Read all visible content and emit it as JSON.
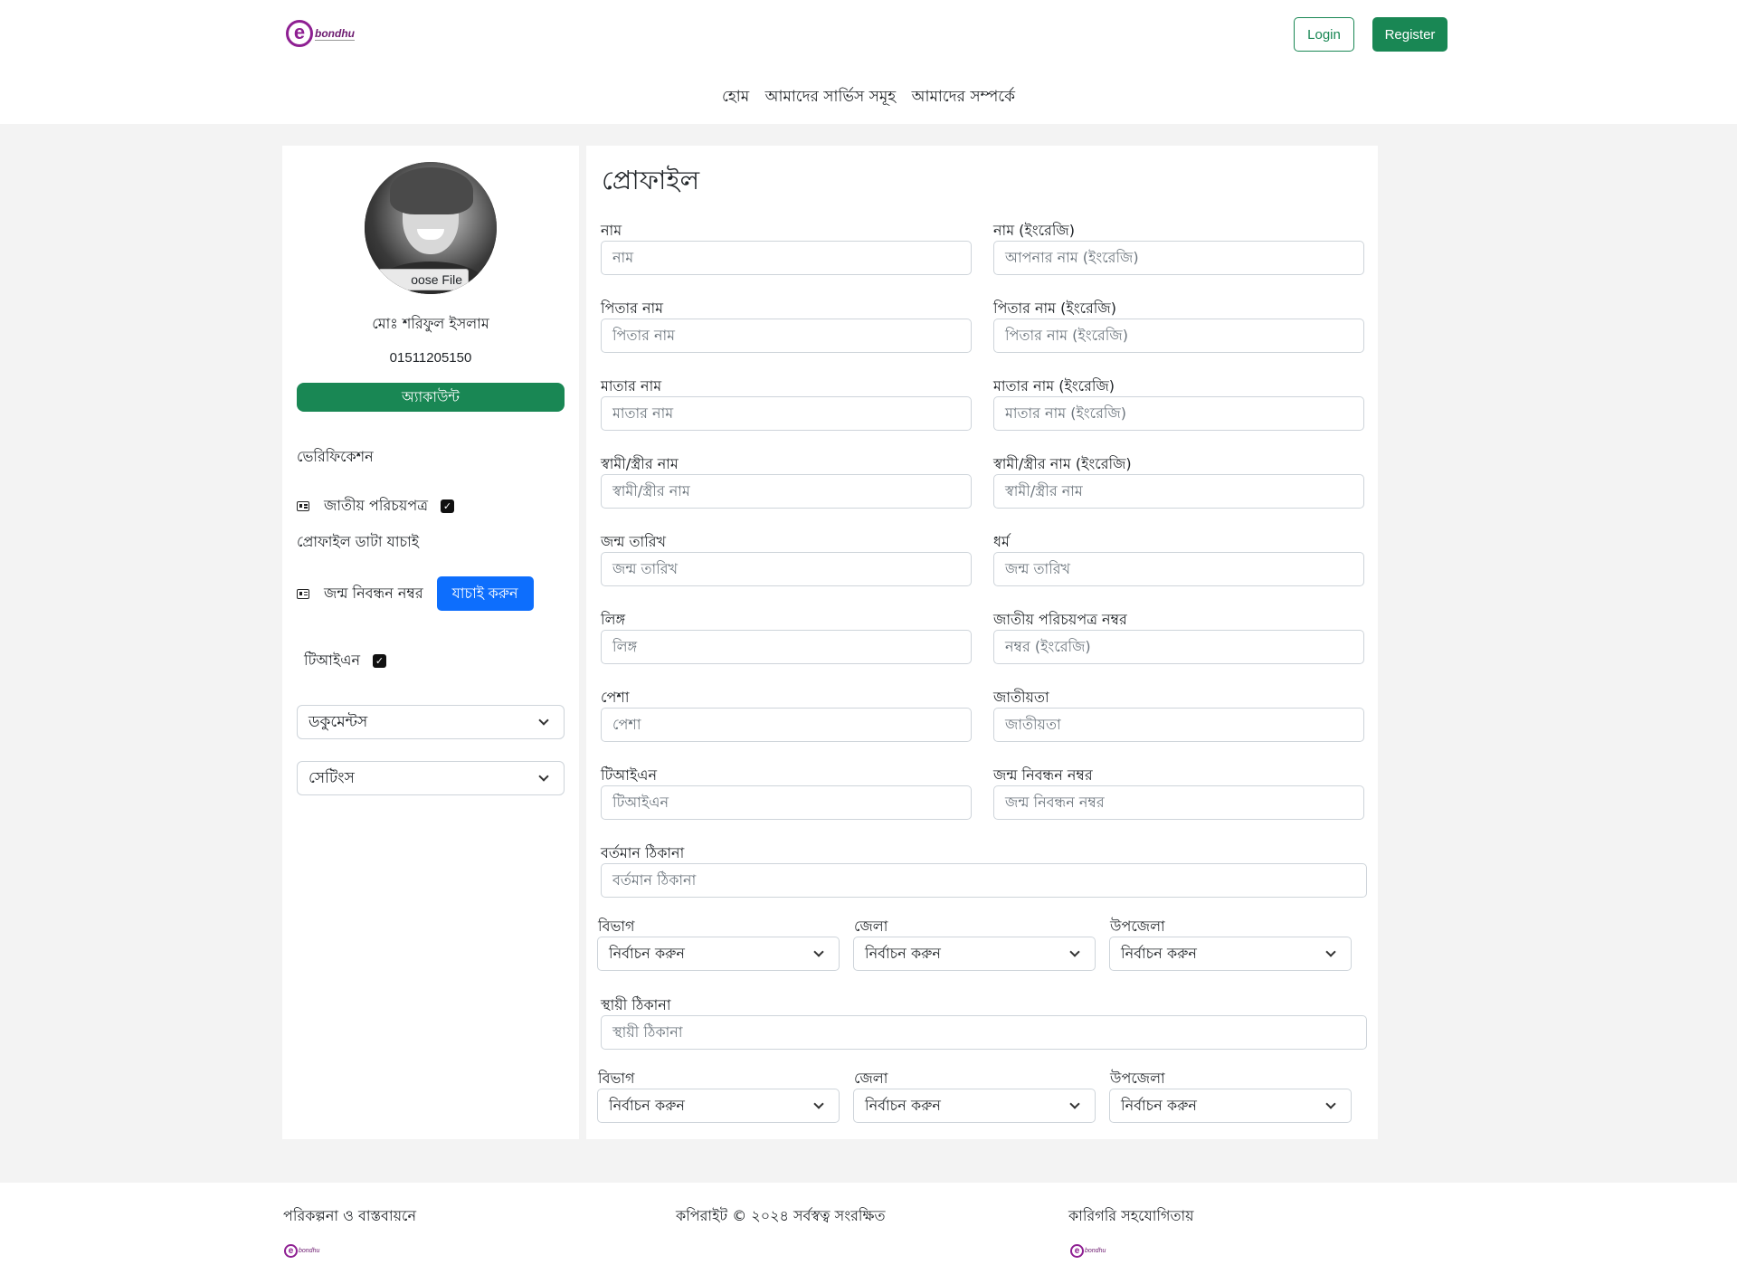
{
  "header": {
    "logo_letter": "e",
    "logo_text": "bondhu",
    "login_label": "Login",
    "register_label": "Register",
    "nav": [
      "হোম",
      "আমাদের সার্ভিস সমূহ",
      "আমাদের সম্পর্কে"
    ]
  },
  "sidebar": {
    "choose_file": "oose File",
    "user_name": "মোঃ শরিফুল ইসলাম",
    "phone": "01511205150",
    "account_label": "অ্যাকাউন্ট",
    "verification_title": "ভেরিফিকেশন",
    "nid_label": "জাতীয় পরিচয়পত্র",
    "profile_data_check": "প্রোফাইল ডাটা যাচাই",
    "birth_reg_label": "জন্ম নিবন্ধন নম্বর",
    "verify_button": "যাচাই করুন",
    "tin_label": "টিআইএন",
    "documents_label": "ডকুমেন্টস",
    "settings_label": "সেটিংস",
    "check_glyph": "✓"
  },
  "main": {
    "title": "প্রোফাইল",
    "fields": [
      {
        "label": "নাম",
        "placeholder": "নাম"
      },
      {
        "label": "নাম (ইংরেজি)",
        "placeholder": "আপনার নাম (ইংরেজি)"
      },
      {
        "label": "পিতার নাম",
        "placeholder": "পিতার নাম"
      },
      {
        "label": "পিতার নাম (ইংরেজি)",
        "placeholder": "পিতার নাম (ইংরেজি)"
      },
      {
        "label": "মাতার নাম",
        "placeholder": "মাতার নাম"
      },
      {
        "label": "মাতার নাম (ইংরেজি)",
        "placeholder": "মাতার  নাম (ইংরেজি)"
      },
      {
        "label": "স্বামী/স্ত্রীর নাম",
        "placeholder": "স্বামী/স্ত্রীর নাম"
      },
      {
        "label": "স্বামী/স্ত্রীর নাম (ইংরেজি)",
        "placeholder": "স্বামী/স্ত্রীর নাম"
      },
      {
        "label": "জন্ম তারিখ",
        "placeholder": "জন্ম তারিখ"
      },
      {
        "label": "ধর্ম",
        "placeholder": "জন্ম তারিখ"
      },
      {
        "label": "লিঙ্গ",
        "placeholder": "লিঙ্গ"
      },
      {
        "label": "জাতীয় পরিচয়পত্র নম্বর",
        "placeholder": " নম্বর (ইংরেজি)"
      },
      {
        "label": "পেশা",
        "placeholder": "পেশা"
      },
      {
        "label": "জাতীয়তা",
        "placeholder": "জাতীয়তা"
      },
      {
        "label": "টিআইএন",
        "placeholder": "টিআইএন"
      },
      {
        "label": "জন্ম নিবন্ধন নম্বর",
        "placeholder": "জন্ম নিবন্ধন নম্বর"
      }
    ],
    "present_address": {
      "label": "বর্তমান ঠিকানা",
      "placeholder": "বর্তমান ঠিকানা"
    },
    "present_selects": [
      {
        "label": "বিভাগ",
        "value": "নির্বাচন করুন"
      },
      {
        "label": "জেলা",
        "value": "নির্বাচন করুন"
      },
      {
        "label": "উপজেলা",
        "value": "নির্বাচন করুন"
      }
    ],
    "permanent_address": {
      "label": "স্থায়ী ঠিকানা",
      "placeholder": "স্থায়ী ঠিকানা"
    },
    "permanent_selects": [
      {
        "label": "বিভাগ",
        "value": "নির্বাচন করুন"
      },
      {
        "label": "জেলা",
        "value": "নির্বাচন করুন"
      },
      {
        "label": "উপজেলা",
        "value": "নির্বাচন করুন"
      }
    ]
  },
  "footer": {
    "planning": "পরিকল্পনা ও বাস্তবায়নে",
    "copyright": "কপিরাইট © ২০২৪ সর্বস্বত্ব সংরক্ষিত",
    "technical": "কারিগরি সহযোগিতায়",
    "logo_letter": "e",
    "logo_text": "bondhu"
  },
  "colors": {
    "brand_green": "#198754",
    "verify_blue": "#0d6efd",
    "logo_purple": "#8e1f92",
    "page_bg": "#f3f3f3"
  }
}
